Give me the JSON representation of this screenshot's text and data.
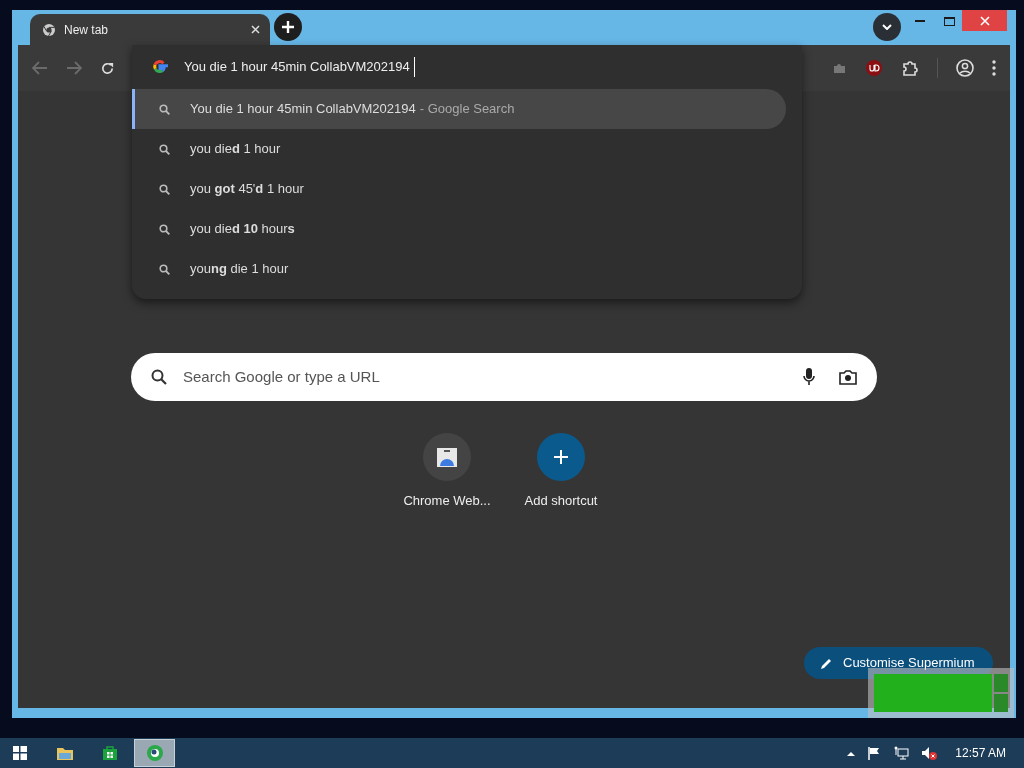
{
  "window": {
    "tabs": [
      {
        "title": "New tab",
        "selected": true
      }
    ]
  },
  "omnibox": {
    "value": "You die 1 hour 45min CollabVM202194"
  },
  "suggestions": [
    {
      "text": "You die 1 hour 45min CollabVM202194",
      "suffix": "- Google Search",
      "selected": true
    },
    {
      "text": "you die**d** 1 hour",
      "selected": false
    },
    {
      "text": "you **got** 45'**d** 1 hour",
      "selected": false
    },
    {
      "text": "you die**d 10** hour**s**",
      "selected": false
    },
    {
      "text": "you**ng** die 1 hour",
      "selected": false
    }
  ],
  "search": {
    "placeholder": "Search Google or type a URL"
  },
  "shortcuts": [
    {
      "kind": "site",
      "label": "Chrome Web..."
    },
    {
      "kind": "add",
      "label": "Add shortcut"
    }
  ],
  "customise_button": {
    "label": "Customise Supermium"
  },
  "taskbar": {
    "apps": [
      {
        "kind": "files",
        "selected": false
      },
      {
        "kind": "store",
        "selected": false
      },
      {
        "kind": "browser",
        "selected": true
      }
    ],
    "clock": "12:57 AM"
  }
}
